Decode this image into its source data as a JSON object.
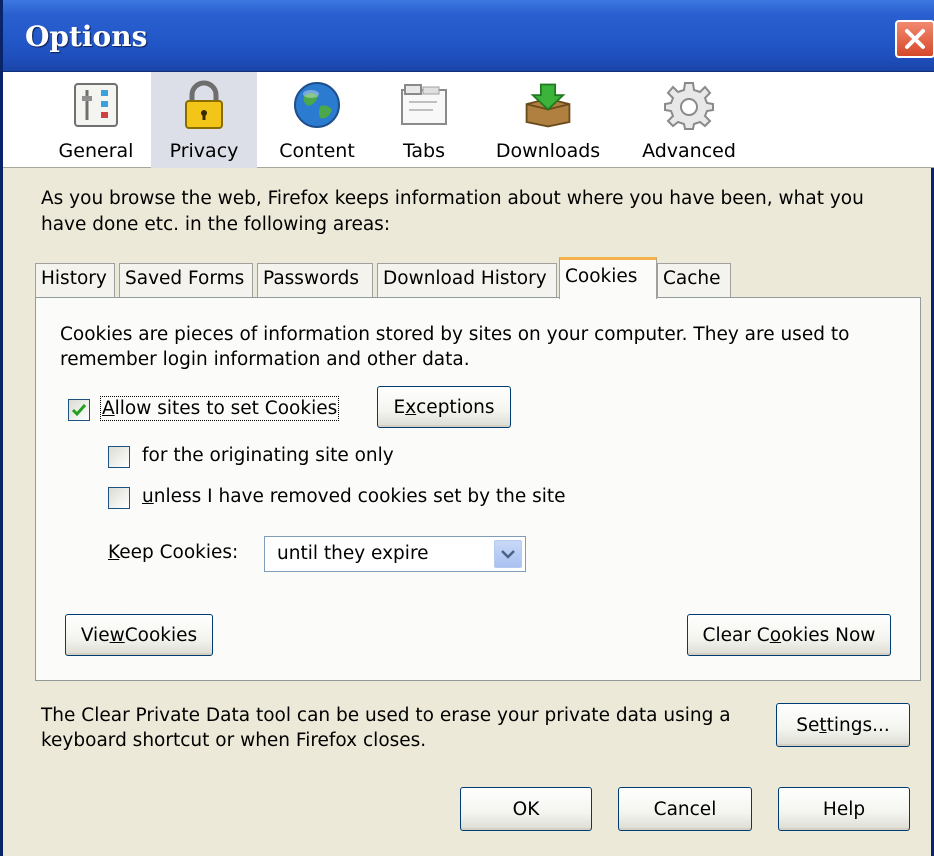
{
  "window": {
    "title": "Options",
    "colors": {
      "titlebar": "#2358c9",
      "close": "#d8482a",
      "panel_bg": "#ece9d8",
      "accent_tab": "#f5b24a"
    }
  },
  "panes": [
    {
      "label": "General",
      "icon": "general-sliders-icon",
      "selected": false
    },
    {
      "label": "Privacy",
      "icon": "padlock-icon",
      "selected": true
    },
    {
      "label": "Content",
      "icon": "globe-icon",
      "selected": false
    },
    {
      "label": "Tabs",
      "icon": "tabs-window-icon",
      "selected": false
    },
    {
      "label": "Downloads",
      "icon": "download-box-icon",
      "selected": false
    },
    {
      "label": "Advanced",
      "icon": "gear-icon",
      "selected": false
    }
  ],
  "intro": "As you browse the web, Firefox keeps information about where you have been, what you have done etc. in the following areas:",
  "tabs": [
    {
      "label": "History",
      "active": false
    },
    {
      "label": "Saved Forms",
      "active": false
    },
    {
      "label": "Passwords",
      "active": false
    },
    {
      "label": "Download History",
      "active": false
    },
    {
      "label": "Cookies",
      "active": true
    },
    {
      "label": "Cache",
      "active": false
    }
  ],
  "cookies": {
    "description": "Cookies are pieces of information stored by sites on your computer. They are used to remember login information and other data.",
    "allow": {
      "pre": "",
      "key": "A",
      "post": "llow sites to set Cookies",
      "checked": true
    },
    "exceptions": {
      "pre": "E",
      "key": "x",
      "post": "ceptions"
    },
    "originating": {
      "text": "for the originating site only",
      "checked": false
    },
    "unless": {
      "pre": "",
      "key": "u",
      "post": "nless I have removed cookies set by the site",
      "checked": false
    },
    "keep": {
      "pre": "",
      "key": "K",
      "post": "eep Cookies:",
      "value": "until they expire"
    },
    "view": {
      "pre": "Vie",
      "key": "w",
      "post": " Cookies"
    },
    "clear": {
      "pre": "Clear C",
      "key": "o",
      "post": "okies Now"
    }
  },
  "footer": {
    "text": "The Clear Private Data tool can be used to erase your private data using a keyboard shortcut or when Firefox closes.",
    "settings": {
      "pre": "Se",
      "key": "t",
      "post": "tings..."
    }
  },
  "buttons": {
    "ok": "OK",
    "cancel": "Cancel",
    "help": "Help"
  }
}
